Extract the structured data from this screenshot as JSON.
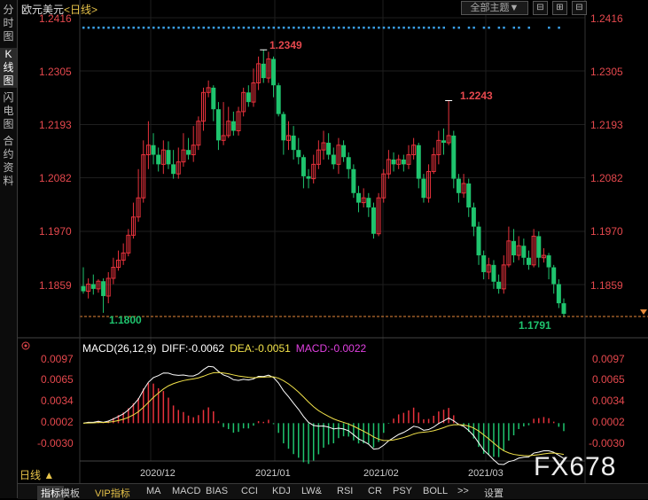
{
  "sidebar": {
    "tabs": [
      "分时图",
      "K线图",
      "闪电图",
      "合约资料"
    ],
    "active_index": 1
  },
  "header": {
    "symbol": "欧元美元",
    "period": "<日线>",
    "theme_button": "全部主题▼",
    "controls": [
      "⊟",
      "⊞",
      "⊟"
    ]
  },
  "price_axis": {
    "ticks": [
      "1.2416",
      "1.2305",
      "1.2193",
      "1.2082",
      "1.1970",
      "1.1859"
    ]
  },
  "annotations": {
    "high1": "1.2349",
    "high2": "1.2243",
    "low1": "1.1800",
    "low2": "1.1791"
  },
  "macd": {
    "title": "MACD(26,12,9)",
    "diff_text": "DIFF:-0.0062",
    "dea_text": "DEA:-0.0051",
    "macd_text": "MACD:-0.0022",
    "axis_ticks": [
      "0.0097",
      "0.0065",
      "0.0034",
      "0.0002",
      "-0.0030"
    ]
  },
  "date_axis": [
    "2020/12",
    "2021/01",
    "2021/02",
    "2021/03"
  ],
  "period_selector": "日线 ▲",
  "toolbar": [
    "指标",
    "模板",
    "VIP指标",
    "MA",
    "MACD",
    "BIAS",
    "CCI",
    "KDJ",
    "LW&",
    "RSI",
    "CR",
    "PSY",
    "BOLL",
    ">>",
    "设置"
  ],
  "watermark": "FX678",
  "colors": {
    "up": "#e8323c",
    "down": "#1fc46e",
    "diff": "#ffffff",
    "dea": "#f2e24a",
    "macd_label": "#e040e0",
    "axis": "#e5484d"
  },
  "chart_data": {
    "type": "candlestick",
    "y_ticks": [
      1.1859,
      1.197,
      1.2082,
      1.2193,
      1.2305,
      1.2416
    ],
    "high_marker": 1.2349,
    "high_marker2": 1.2243,
    "low_marker": 1.18,
    "last_low": 1.1791,
    "candles": [
      [
        1.1856,
        1.1845,
        1.1895,
        1.184
      ],
      [
        1.1845,
        1.186,
        1.1872,
        1.183
      ],
      [
        1.186,
        1.185,
        1.188,
        1.1838
      ],
      [
        1.185,
        1.1866,
        1.187,
        1.1842
      ],
      [
        1.1866,
        1.1835,
        1.1872,
        1.18
      ],
      [
        1.1835,
        1.1872,
        1.1885,
        1.182
      ],
      [
        1.1872,
        1.1895,
        1.1915,
        1.186
      ],
      [
        1.1895,
        1.191,
        1.193,
        1.1888
      ],
      [
        1.191,
        1.1925,
        1.1945,
        1.19
      ],
      [
        1.1925,
        1.1962,
        1.1975,
        1.1918
      ],
      [
        1.1962,
        1.2,
        1.203,
        1.1955
      ],
      [
        1.2,
        1.204,
        1.21,
        1.199
      ],
      [
        1.204,
        1.213,
        1.216,
        1.203
      ],
      [
        1.213,
        1.215,
        1.22,
        1.21
      ],
      [
        1.215,
        1.213,
        1.2175,
        1.211
      ],
      [
        1.213,
        1.211,
        1.2145,
        1.2095
      ],
      [
        1.211,
        1.214,
        1.216,
        1.209
      ],
      [
        1.214,
        1.211,
        1.2158,
        1.21
      ],
      [
        1.211,
        1.209,
        1.214,
        1.208
      ],
      [
        1.209,
        1.2115,
        1.2145,
        1.208
      ],
      [
        1.2115,
        1.214,
        1.2175,
        1.2105
      ],
      [
        1.214,
        1.213,
        1.2165,
        1.212
      ],
      [
        1.213,
        1.215,
        1.219,
        1.2115
      ],
      [
        1.215,
        1.22,
        1.221,
        1.214
      ],
      [
        1.22,
        1.226,
        1.227,
        1.218
      ],
      [
        1.226,
        1.227,
        1.2285,
        1.225
      ],
      [
        1.227,
        1.2225,
        1.2275,
        1.22
      ],
      [
        1.2225,
        1.216,
        1.224,
        1.214
      ],
      [
        1.216,
        1.217,
        1.224,
        1.215
      ],
      [
        1.217,
        1.22,
        1.223,
        1.2165
      ],
      [
        1.22,
        1.218,
        1.222,
        1.217
      ],
      [
        1.218,
        1.222,
        1.223,
        1.217
      ],
      [
        1.222,
        1.226,
        1.227,
        1.221
      ],
      [
        1.226,
        1.224,
        1.2275,
        1.223
      ],
      [
        1.224,
        1.228,
        1.231,
        1.223
      ],
      [
        1.228,
        1.232,
        1.2335,
        1.2265
      ],
      [
        1.232,
        1.229,
        1.2349,
        1.228
      ],
      [
        1.229,
        1.233,
        1.2345,
        1.228
      ],
      [
        1.233,
        1.2275,
        1.2335,
        1.225
      ],
      [
        1.2275,
        1.2215,
        1.228,
        1.221
      ],
      [
        1.2215,
        1.216,
        1.222,
        1.213
      ],
      [
        1.216,
        1.217,
        1.22,
        1.214
      ],
      [
        1.217,
        1.214,
        1.219,
        1.212
      ],
      [
        1.214,
        1.2125,
        1.2165,
        1.211
      ],
      [
        1.2125,
        1.2085,
        1.213,
        1.206
      ],
      [
        1.2085,
        1.208,
        1.21,
        1.206
      ],
      [
        1.208,
        1.211,
        1.213,
        1.207
      ],
      [
        1.211,
        1.214,
        1.216,
        1.21
      ],
      [
        1.214,
        1.2155,
        1.218,
        1.212
      ],
      [
        1.2155,
        1.213,
        1.2175,
        1.212
      ],
      [
        1.213,
        1.211,
        1.2145,
        1.21
      ],
      [
        1.211,
        1.215,
        1.2165,
        1.209
      ],
      [
        1.215,
        1.2125,
        1.216,
        1.2115
      ],
      [
        1.2125,
        1.21,
        1.2135,
        1.208
      ],
      [
        1.21,
        1.205,
        1.211,
        1.204
      ],
      [
        1.205,
        1.203,
        1.2065,
        1.201
      ],
      [
        1.203,
        1.204,
        1.206,
        1.202
      ],
      [
        1.204,
        1.202,
        1.205,
        1.2
      ],
      [
        1.202,
        1.1965,
        1.203,
        1.1955
      ],
      [
        1.1965,
        1.204,
        1.205,
        1.196
      ],
      [
        1.204,
        1.209,
        1.21,
        1.203
      ],
      [
        1.209,
        1.212,
        1.214,
        1.208
      ],
      [
        1.212,
        1.211,
        1.2135,
        1.2095
      ],
      [
        1.211,
        1.212,
        1.213,
        1.21
      ],
      [
        1.212,
        1.211,
        1.213,
        1.2095
      ],
      [
        1.211,
        1.213,
        1.215,
        1.21
      ],
      [
        1.213,
        1.215,
        1.2165,
        1.212
      ],
      [
        1.215,
        1.208,
        1.2155,
        1.206
      ],
      [
        1.208,
        1.204,
        1.209,
        1.203
      ],
      [
        1.204,
        1.2095,
        1.211,
        1.203
      ],
      [
        1.2095,
        1.213,
        1.2145,
        1.209
      ],
      [
        1.213,
        1.216,
        1.218,
        1.211
      ],
      [
        1.216,
        1.2155,
        1.2185,
        1.213
      ],
      [
        1.2155,
        1.217,
        1.2243,
        1.215
      ],
      [
        1.217,
        1.208,
        1.218,
        1.206
      ],
      [
        1.208,
        1.205,
        1.209,
        1.203
      ],
      [
        1.205,
        1.207,
        1.209,
        1.204
      ],
      [
        1.207,
        1.202,
        1.208,
        1.2
      ],
      [
        1.202,
        1.198,
        1.203,
        1.196
      ],
      [
        1.198,
        1.192,
        1.199,
        1.19
      ],
      [
        1.192,
        1.1885,
        1.193,
        1.187
      ],
      [
        1.1885,
        1.19,
        1.1915,
        1.187
      ],
      [
        1.19,
        1.1865,
        1.191,
        1.185
      ],
      [
        1.1865,
        1.185,
        1.188,
        1.184
      ],
      [
        1.185,
        1.19,
        1.192,
        1.184
      ],
      [
        1.19,
        1.195,
        1.198,
        1.1895
      ],
      [
        1.195,
        1.192,
        1.1975,
        1.1905
      ],
      [
        1.192,
        1.194,
        1.196,
        1.191
      ],
      [
        1.194,
        1.1915,
        1.1955,
        1.19
      ],
      [
        1.1915,
        1.19,
        1.193,
        1.189
      ],
      [
        1.19,
        1.196,
        1.1975,
        1.1895
      ],
      [
        1.196,
        1.1915,
        1.197,
        1.1895
      ],
      [
        1.1915,
        1.192,
        1.1935,
        1.1905
      ],
      [
        1.192,
        1.1895,
        1.1925,
        1.187
      ],
      [
        1.1895,
        1.186,
        1.19,
        1.184
      ],
      [
        1.186,
        1.182,
        1.187,
        1.181
      ],
      [
        1.182,
        1.1798,
        1.183,
        1.1791
      ]
    ]
  }
}
